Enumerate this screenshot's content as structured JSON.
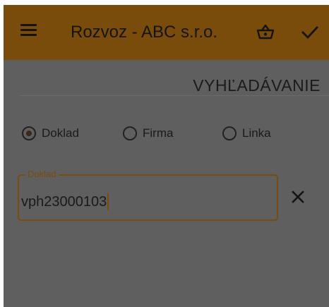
{
  "appbar": {
    "title": "Rozvoz - ABC s.r.o.",
    "menu_icon": "hamburger-menu-icon",
    "basket_icon": "basket-icon",
    "confirm_icon": "checkmark-icon",
    "background_color": "#7a4c0c"
  },
  "search": {
    "title": "VYHĽADÁVANIE",
    "radios": [
      {
        "label": "Doklad",
        "checked": true
      },
      {
        "label": "Firma",
        "checked": false
      },
      {
        "label": "Linka",
        "checked": false
      }
    ],
    "field": {
      "label": "Doklad",
      "value": "vph23000103"
    },
    "clear_icon": "close-icon"
  },
  "colors": {
    "accent": "#7a4c0c",
    "overlay_background": "#5f5f5f"
  }
}
